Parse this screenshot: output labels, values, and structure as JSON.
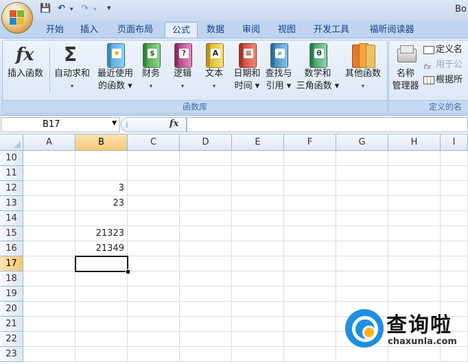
{
  "title_bar": {
    "title": "Bo"
  },
  "quick_access": {
    "save": "💾",
    "undo": "↶",
    "redo": "↷",
    "customize": "▾"
  },
  "tabs": [
    "开始",
    "插入",
    "页面布局",
    "公式",
    "数据",
    "审阅",
    "视图",
    "开发工具",
    "福昕阅读器"
  ],
  "active_tab": "公式",
  "ribbon": {
    "function_library": {
      "label": "函数库",
      "buttons": [
        {
          "line1": "插入函数",
          "line2": "",
          "icon": "fx-icon"
        },
        {
          "line1": "自动求和",
          "line2": "▾",
          "icon": "sigma-icon"
        },
        {
          "line1": "最近使用",
          "line2": "的函数 ▾",
          "icon": "star-book-icon"
        },
        {
          "line1": "财务",
          "line2": "▾",
          "icon": "finance-book-icon"
        },
        {
          "line1": "逻辑",
          "line2": "▾",
          "icon": "question-book-icon"
        },
        {
          "line1": "文本",
          "line2": "▾",
          "icon": "text-book-icon"
        },
        {
          "line1": "日期和",
          "line2": "时间 ▾",
          "icon": "calendar-book-icon"
        },
        {
          "line1": "查找与",
          "line2": "引用 ▾",
          "icon": "search-book-icon"
        },
        {
          "line1": "数学和",
          "line2": "三角函数 ▾",
          "icon": "theta-book-icon"
        },
        {
          "line1": "其他函数",
          "line2": "▾",
          "icon": "more-books-icon"
        }
      ]
    },
    "defined_names": {
      "label": "定义的名",
      "name_manager_line1": "名称",
      "name_manager_line2": "管理器",
      "define_name": "定义名",
      "use_in_formula": "用于公",
      "create_from_selection": "根据所"
    }
  },
  "formula_bar": {
    "name_box": "B17",
    "fx": "fx",
    "formula": ""
  },
  "columns": [
    "A",
    "B",
    "C",
    "D",
    "E",
    "F",
    "G",
    "H",
    "I"
  ],
  "selected_column": "B",
  "rows": [
    {
      "num": "10",
      "b": ""
    },
    {
      "num": "11",
      "b": ""
    },
    {
      "num": "12",
      "b": "3"
    },
    {
      "num": "13",
      "b": "23"
    },
    {
      "num": "14",
      "b": ""
    },
    {
      "num": "15",
      "b": "21323"
    },
    {
      "num": "16",
      "b": "21349"
    },
    {
      "num": "17",
      "b": ""
    },
    {
      "num": "18",
      "b": ""
    },
    {
      "num": "19",
      "b": ""
    },
    {
      "num": "20",
      "b": ""
    },
    {
      "num": "21",
      "b": ""
    },
    {
      "num": "22",
      "b": ""
    },
    {
      "num": "23",
      "b": ""
    }
  ],
  "selected_row": "17",
  "watermark": {
    "text": "查询啦",
    "sub": "chaxunla.com"
  },
  "colors": {
    "accent": "#15428b",
    "selection_header": "#f8c877",
    "watermark_blue": "#1f8fe0",
    "watermark_orange": "#ffb21f"
  }
}
